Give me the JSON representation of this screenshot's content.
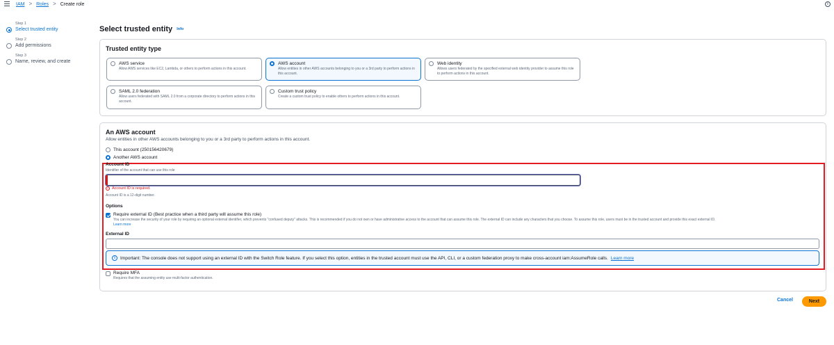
{
  "breadcrumb": {
    "items": [
      "IAM",
      "Roles"
    ],
    "separator": ">",
    "current": "Create role"
  },
  "icons": {
    "menu": "hamburger-icon",
    "help": "info-circle-icon"
  },
  "steps": [
    {
      "number": "Step 1",
      "label": "Select trusted entity",
      "active": true
    },
    {
      "number": "Step 2",
      "label": "Add permissions",
      "active": false
    },
    {
      "number": "Step 3",
      "label": "Name, review, and create",
      "active": false
    }
  ],
  "page": {
    "title": "Select trusted entity",
    "info_link": "Info"
  },
  "trusted_entity": {
    "heading": "Trusted entity type",
    "tiles": [
      {
        "title": "AWS service",
        "desc": "Allow AWS services like EC2, Lambda, or others to perform actions in this account.",
        "selected": false
      },
      {
        "title": "AWS account",
        "desc": "Allow entities in other AWS accounts belonging to you or a 3rd party to perform actions in this account.",
        "selected": true
      },
      {
        "title": "Web identity",
        "desc": "Allows users federated by the specified external web identity provider to assume this role to perform actions in this account.",
        "selected": false
      },
      {
        "title": "SAML 2.0 federation",
        "desc": "Allow users federated with SAML 2.0 from a corporate directory to perform actions in this account.",
        "selected": false
      },
      {
        "title": "Custom trust policy",
        "desc": "Create a custom trust policy to enable others to perform actions in this account.",
        "selected": false
      }
    ]
  },
  "aws_account": {
    "heading": "An AWS account",
    "desc": "Allow entities in other AWS accounts belonging to you or a 3rd party to perform actions in this account.",
    "option_this": "This account (250156420679)",
    "option_another": "Another AWS account",
    "account_id_label": "Account ID",
    "account_id_hint": "Identifier of the account that can use this role",
    "account_id_value": "",
    "account_id_error": "Account ID is required.",
    "account_id_constraint": "Account ID is a 12-digit number.",
    "options_label": "Options",
    "external_id_check": "Require external ID (Best practice when a third party will assume this role)",
    "external_id_desc": "You can increase the security of your role by requiring an optional external identifier, which prevents \"confused deputy\" attacks. This is recommended if you do not own or have administrative access to the account that can assume this role. The external ID can include any characters that you choose. To assume this role, users must be in the trusted account and provide this exact external ID.",
    "learn_more_1": "Learn more",
    "external_id_label": "External ID",
    "external_id_value": "",
    "alert_text": "Important: The console does not support using an external ID with the Switch Role feature. If you select this option, entities in the trusted account must use the API, CLI, or a custom federation proxy to make cross-account iam:AssumeRole calls.",
    "learn_more_2": "Learn more",
    "mfa_check": "Require MFA",
    "mfa_desc": "Requires that the assuming entity use multi-factor authentication."
  },
  "footer": {
    "cancel": "Cancel",
    "next": "Next"
  },
  "colors": {
    "accent": "#0972d3",
    "error": "#d91515",
    "highlight_box": "#e31b23",
    "primary_button": "#ff9900"
  }
}
